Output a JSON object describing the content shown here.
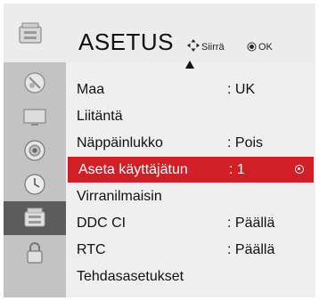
{
  "header": {
    "title": "ASETUS",
    "move_hint": "Siirrä",
    "ok_hint": "OK",
    "icon": "setup-box-icon"
  },
  "sidebar": {
    "items": [
      {
        "icon": "satellite-dish-icon",
        "active": false
      },
      {
        "icon": "tv-monitor-icon",
        "active": false
      },
      {
        "icon": "speaker-icon",
        "active": false
      },
      {
        "icon": "clock-icon",
        "active": false
      },
      {
        "icon": "setup-box-icon",
        "active": true
      },
      {
        "icon": "lock-icon",
        "active": false
      }
    ]
  },
  "menu": {
    "items": [
      {
        "label": "Maa",
        "value": ": UK"
      },
      {
        "label": "Liitäntä",
        "value": ""
      },
      {
        "label": "Näppäinlukko",
        "value": ": Pois"
      },
      {
        "label": "Aseta käyttäjätun",
        "value": ": 1",
        "selected": true
      },
      {
        "label": "Virranilmaisin",
        "value": ""
      },
      {
        "label": "DDC CI",
        "value": ": Päällä"
      },
      {
        "label": "RTC",
        "value": ": Päällä"
      },
      {
        "label": "Tehdasasetukset",
        "value": ""
      }
    ]
  },
  "colors": {
    "highlight": "#d11f27",
    "active_sidebar": "#5c5c5c",
    "panel": "#efefef"
  }
}
